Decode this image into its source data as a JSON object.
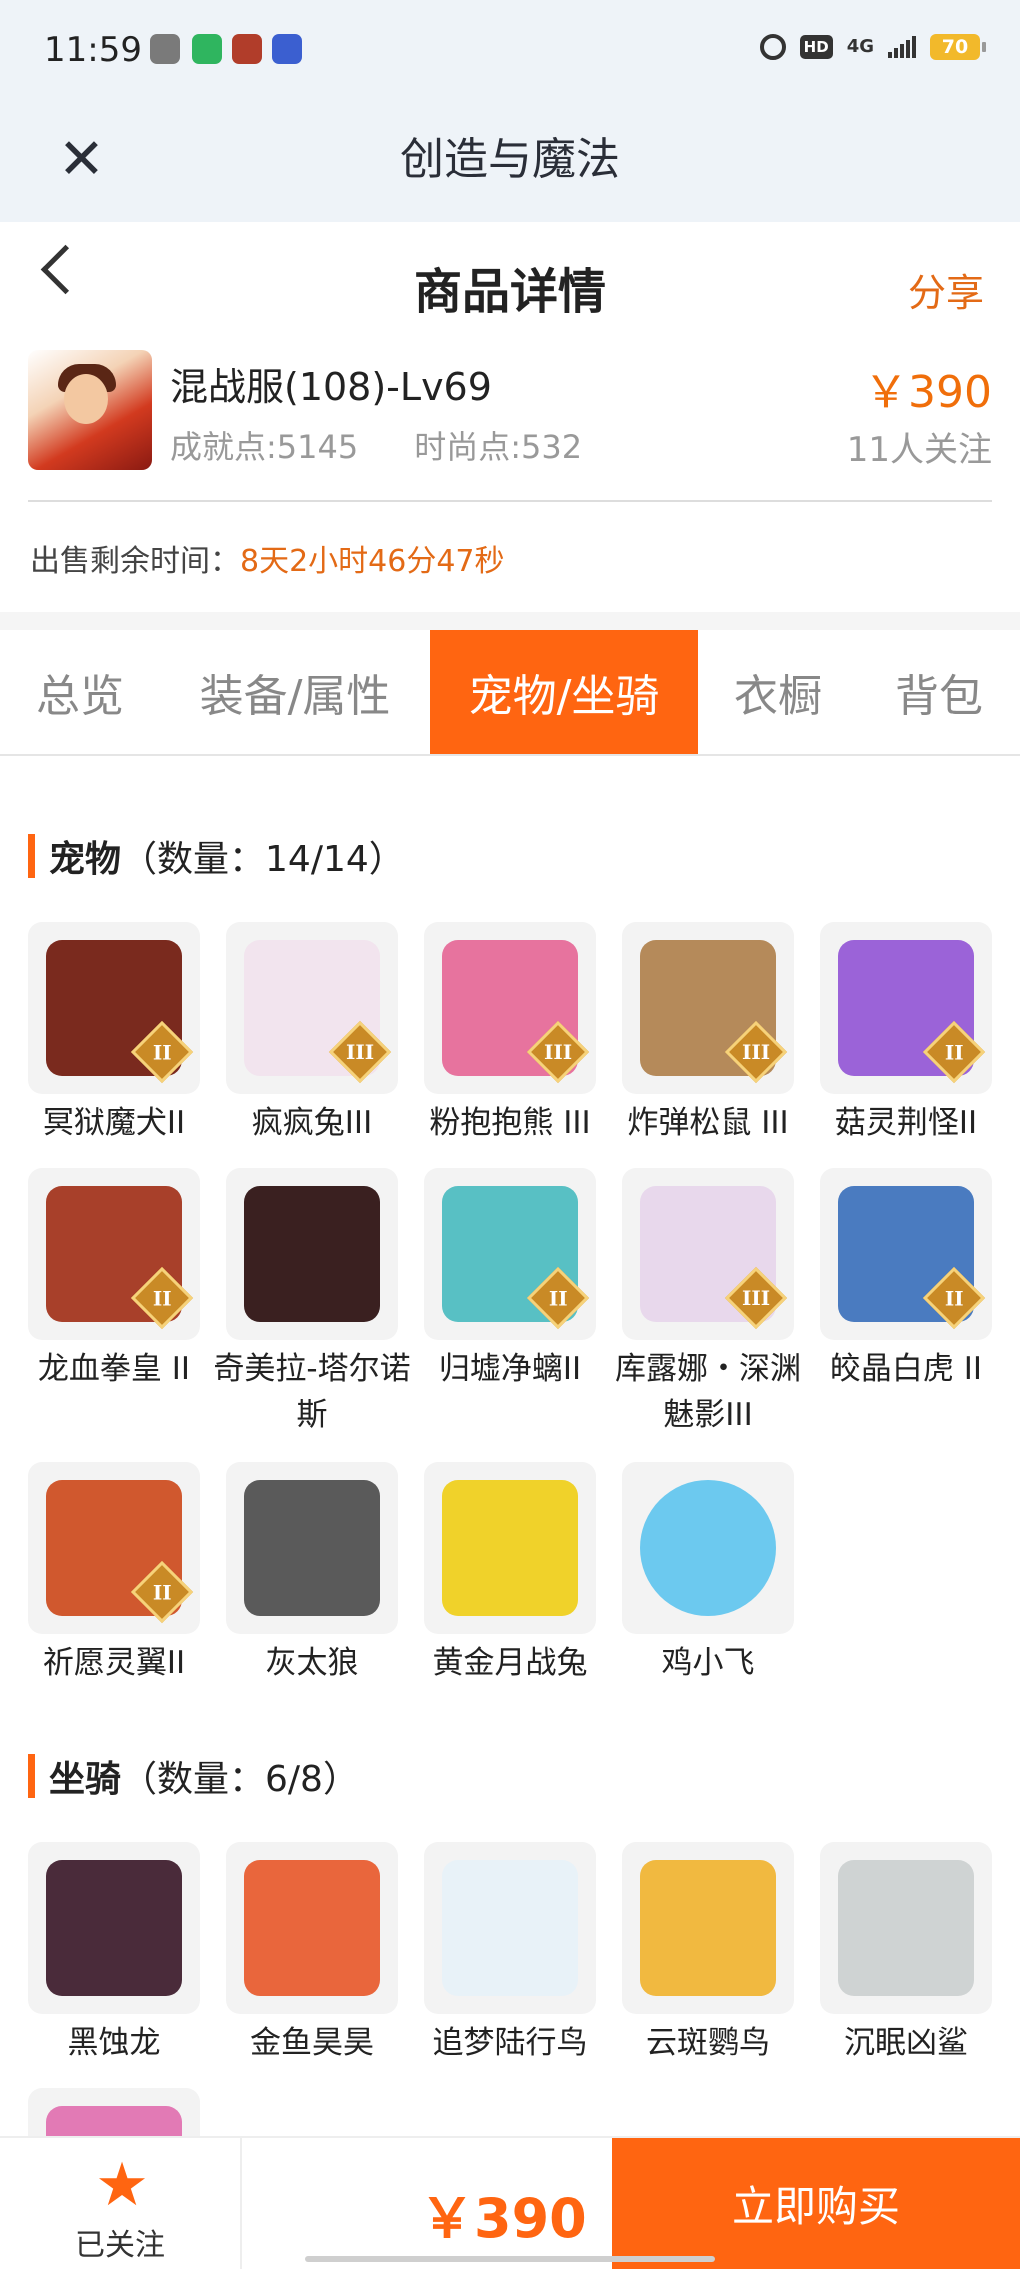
{
  "status_bar": {
    "time": "11:59",
    "network": "4G",
    "hd": "HD",
    "battery": "70",
    "app_icon_colors": [
      "#7a7a7a",
      "#2fb55f",
      "#b13d2a",
      "#3b5fd0"
    ]
  },
  "app_bar": {
    "title": "创造与魔法"
  },
  "header": {
    "title": "商品详情",
    "share_label": "分享"
  },
  "product": {
    "name": "混战服(108)-Lv69",
    "achievement": "成就点:5145",
    "fashion": "时尚点:532",
    "price": "￥390",
    "followers": "11人关注"
  },
  "sale_time": {
    "label": "出售剩余时间：",
    "value": "8天2小时46分47秒"
  },
  "tabs": [
    {
      "label": "总览",
      "active": false
    },
    {
      "label": "装备/属性",
      "active": false
    },
    {
      "label": "宠物/坐骑",
      "active": true
    },
    {
      "label": "衣橱",
      "active": false
    },
    {
      "label": "背包",
      "active": false
    }
  ],
  "pets_section": {
    "title": "宠物",
    "count": "（数量：14/14）",
    "items": [
      {
        "name": "冥狱魔犬II",
        "badge": "II",
        "color": "#7a2a1e"
      },
      {
        "name": "疯疯兔III",
        "badge": "III",
        "color": "#f2e4ee"
      },
      {
        "name": "粉抱抱熊 III",
        "badge": "III",
        "color": "#e7739e"
      },
      {
        "name": "炸弹松鼠 III",
        "badge": "III",
        "color": "#b58a5a"
      },
      {
        "name": "菇灵荆怪II",
        "badge": "II",
        "color": "#9b63d8"
      },
      {
        "name": "龙血拳皇 II",
        "badge": "II",
        "color": "#a8402a"
      },
      {
        "name": "奇美拉-塔尔诺斯",
        "badge": "",
        "color": "#3a2020"
      },
      {
        "name": "归墟净螭II",
        "badge": "II",
        "color": "#58c0c4"
      },
      {
        "name": "库露娜・深渊魅影III",
        "badge": "III",
        "color": "#e8d8ec"
      },
      {
        "name": "皎晶白虎 II",
        "badge": "II",
        "color": "#4a7bc0"
      },
      {
        "name": "祈愿灵翼II",
        "badge": "II",
        "color": "#d0582e"
      },
      {
        "name": "灰太狼",
        "badge": "",
        "color": "#5a5a5a"
      },
      {
        "name": "黄金月战兔",
        "badge": "",
        "color": "#f0d22a"
      },
      {
        "name": "鸡小飞",
        "badge": "",
        "color": "#6cc9ef"
      }
    ]
  },
  "mounts_section": {
    "title": "坐骑",
    "count": "（数量：6/8）",
    "items": [
      {
        "name": "黑蚀龙",
        "color": "#4a2b3a"
      },
      {
        "name": "金鱼昊昊",
        "color": "#e9663c"
      },
      {
        "name": "追梦陆行鸟",
        "color": "#e8f2f8"
      },
      {
        "name": "云斑鹦鸟",
        "color": "#f1b940"
      },
      {
        "name": "沉眠凶鲨",
        "color": "#cfd3d3"
      },
      {
        "name": "",
        "color": "#e27ab5"
      }
    ]
  },
  "bottom": {
    "follow_label": "已关注",
    "price": "￥390",
    "buy_label": "立即购买"
  }
}
